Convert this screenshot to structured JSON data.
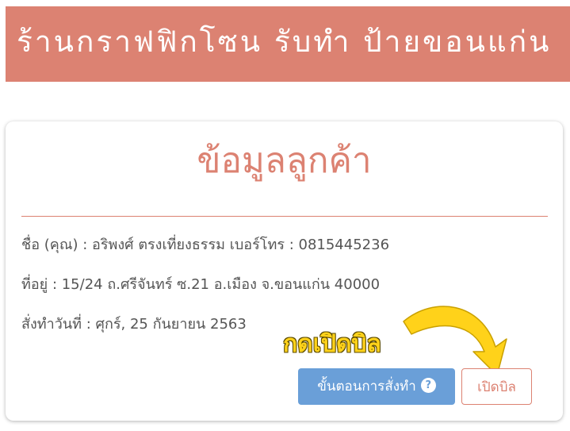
{
  "banner": {
    "title": "ร้านกราฟฟิกโซน รับทำ ป้ายขอนแก่น"
  },
  "card": {
    "title": "ข้อมูลลูกค้า",
    "name_line": "ชื่อ (คุณ) : อริพงศ์ ตรงเที่ยงธรรม เบอร์โทร : 0815445236",
    "address_line": "ที่อยู่ : 15/24 ถ.ศรีจันทร์ ซ.21 อ.เมือง จ.ขอนแก่น 40000",
    "order_date_line": "สั่งทำวันที่ : ศุกร์, 25 กันยายน 2563",
    "hint_text": "กดเปิดบิล",
    "steps_button_label": "ขั้นตอนการสั่งทำ",
    "help_icon_glyph": "?",
    "open_bill_button_label": "เปิดบิล"
  },
  "colors": {
    "accent": "#dc8272",
    "button_blue": "#6a9fd8",
    "hint_yellow": "#ffd21a"
  },
  "icons": {
    "help": "question-circle-icon",
    "pointer": "curved-arrow-icon"
  }
}
